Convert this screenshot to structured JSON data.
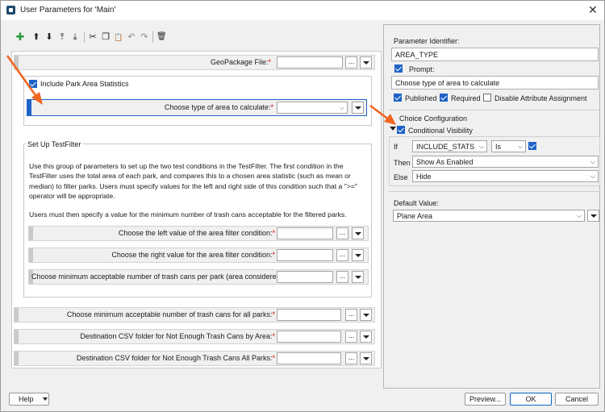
{
  "window": {
    "title": "User Parameters for 'Main'",
    "close_glyph": "✕"
  },
  "toolbar": {
    "icons": [
      "add-icon",
      "move-up-icon",
      "move-down-icon",
      "move-top-icon",
      "move-bottom-icon",
      "cut-icon",
      "copy-icon",
      "paste-icon",
      "undo-icon",
      "redo-icon",
      "delete-icon"
    ],
    "glyphs": {
      "add": "✚",
      "up": "⬆",
      "down": "⬇",
      "top": "⤒",
      "bottom": "⤓",
      "cut": "✂",
      "copy": "❐",
      "paste": "📋",
      "undo": "↶",
      "redo": "↷",
      "delete": "🗑"
    }
  },
  "parameters": {
    "geopackage_label": "GeoPackage File:",
    "include_park_label": "Include Park Area Statistics",
    "area_type_label": "Choose type of area to calculate:",
    "testfilter_title": "Set Up TestFilter",
    "testfilter_desc_1": "Use this group of parameters to set up the two test conditions in the TestFilter. The first condition in the TestFilter uses the total area of each park, and compares this to a chosen area statistic (such as mean or median) to filter parks. Users must specify values for the left and right side of this condition such that a \">=\" operator will be appropriate.",
    "testfilter_desc_2": "Users must then specify a value for the minimum number of trash cans acceptable for the filtered parks.",
    "left_value_label": "Choose the left value of the area filter condition:",
    "right_value_label": "Choose the right value for the area filter condition:",
    "min_trash_considered_label": "Choose minimum acceptable number of trash cans per park (area considered):",
    "min_trash_all_label": "Choose minimum acceptable number of trash cans for all parks:",
    "dest_by_area_label": "Destination CSV folder for Not Enough Trash Cans by Area:",
    "dest_all_label": "Destination CSV folder for Not Enough Trash Cans All Parks:",
    "required_marker": "*",
    "dots_label": "..."
  },
  "details": {
    "identifier_label": "Parameter Identifier:",
    "identifier_value": "AREA_TYPE",
    "prompt_label": "Prompt:",
    "prompt_value": "Choose type of area to calculate",
    "published_label": "Published",
    "required_label": "Required",
    "disable_attr_label": "Disable Attribute Assignment",
    "choice_config_label": "Choice Configuration",
    "conditional_visibility_label": "Conditional Visibility",
    "if_label": "If",
    "if_value": "INCLUDE_STATS",
    "is_value": "Is",
    "then_label": "Then",
    "then_value": "Show As Enabled",
    "else_label": "Else",
    "else_value": "Hide",
    "default_value_label": "Default Value:",
    "default_value": "Plane Area"
  },
  "footer": {
    "help_label": "Help",
    "preview_label": "Preview...",
    "ok_label": "OK",
    "cancel_label": "Cancel"
  },
  "colors": {
    "accent": "#1e63c7",
    "annotation_arrow": "#f26522",
    "required": "#dd0000"
  }
}
